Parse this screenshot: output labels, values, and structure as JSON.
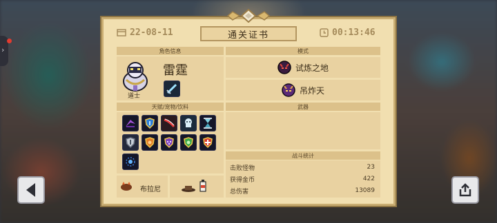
{
  "header": {
    "date": "22-08-11",
    "title": "通关证书",
    "time": "00:13:46"
  },
  "character": {
    "section_label": "角色信息",
    "name": "雷霆",
    "class_name": "道士"
  },
  "talents": {
    "section_label": "天赋/宠物/饮料",
    "pet_name": "布拉尼",
    "icons": [
      "purple-dash-icon",
      "blue-shield-icon",
      "red-slash-icon",
      "ghost-icon",
      "hourglass-icon",
      "grey-shield-icon",
      "orange-shield-icon",
      "purple-shield-icon",
      "green-shield-icon",
      "heal-cross-icon",
      "blue-orb-icon"
    ]
  },
  "mode": {
    "section_label": "模式",
    "items": [
      "试炼之地",
      "吊炸天"
    ]
  },
  "weapon": {
    "section_label": "武器"
  },
  "battle_stats": {
    "section_label": "战斗统计",
    "rows": [
      {
        "label": "击败怪物",
        "value": "23"
      },
      {
        "label": "获得金币",
        "value": "422"
      },
      {
        "label": "总伤害",
        "value": "13089"
      }
    ]
  },
  "colors": {
    "paper": "#f1dfb0",
    "panel": "#e9d2a1",
    "label_band": "#dcc18a",
    "frame": "#c9ad72",
    "accent_red": "#c0392b"
  }
}
